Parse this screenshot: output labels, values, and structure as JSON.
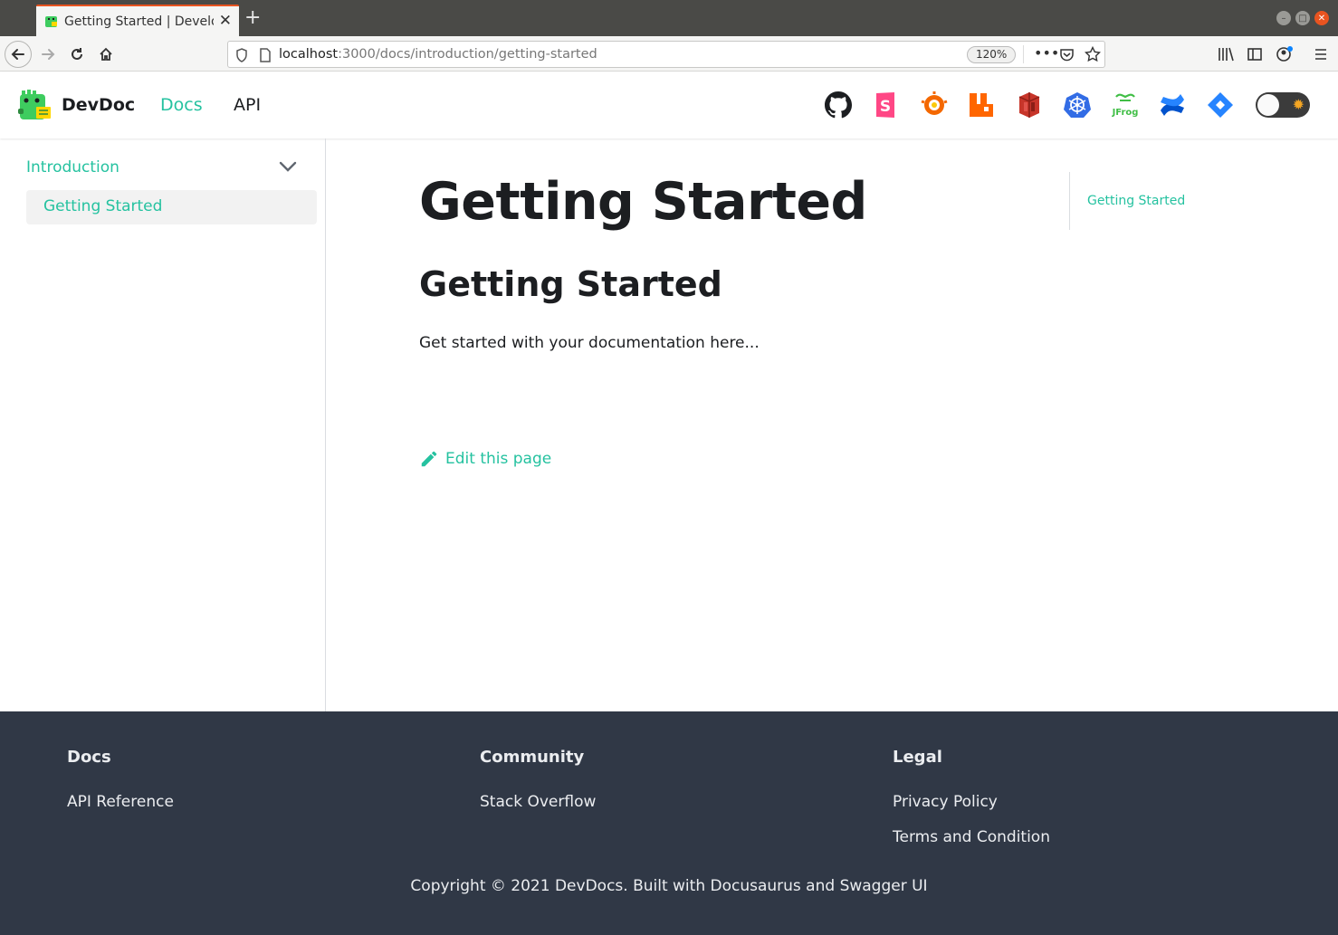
{
  "browser": {
    "tab_title": "Getting Started | Develop",
    "url_host": "localhost",
    "url_rest": ":3000/docs/introduction/getting-started",
    "zoom": "120%"
  },
  "navbar": {
    "brand": "DevDoc",
    "links": {
      "docs": "Docs",
      "api": "API"
    },
    "icons": [
      "github-icon",
      "storybook-icon",
      "grafana-icon",
      "rabbitmq-icon",
      "aws-s3-icon",
      "kubernetes-icon",
      "jfrog-icon",
      "confluence-icon",
      "jira-icon"
    ],
    "accent_color": "#25c2a0"
  },
  "sidebar": {
    "category": "Introduction",
    "items": [
      {
        "label": "Getting Started"
      }
    ]
  },
  "main": {
    "title": "Getting Started",
    "heading": "Getting Started",
    "paragraph": "Get started with your documentation here...",
    "edit_link": "Edit this page"
  },
  "toc": {
    "items": [
      {
        "label": "Getting Started"
      }
    ]
  },
  "footer": {
    "columns": [
      {
        "title": "Docs",
        "links": [
          "API Reference"
        ]
      },
      {
        "title": "Community",
        "links": [
          "Stack Overflow"
        ]
      },
      {
        "title": "Legal",
        "links": [
          "Privacy Policy",
          "Terms and Condition"
        ]
      }
    ],
    "copyright": "Copyright © 2021 DevDocs. Built with Docusaurus and Swagger UI"
  }
}
